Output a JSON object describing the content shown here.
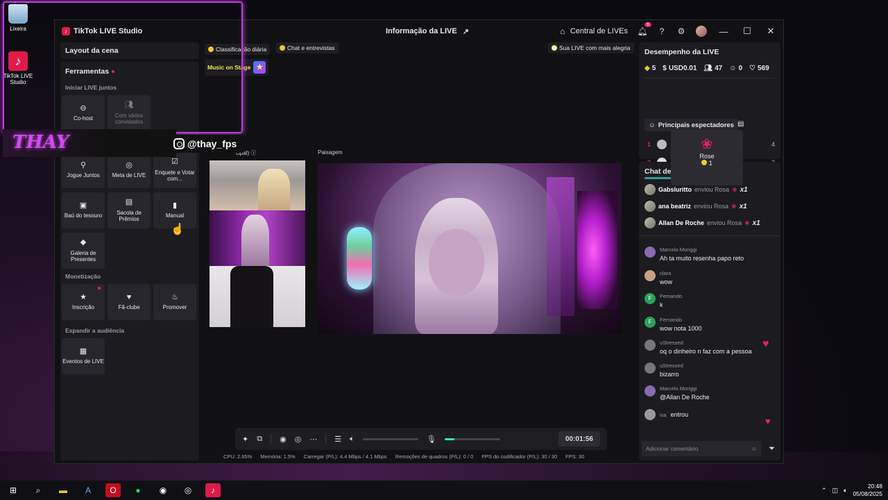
{
  "desktop": {
    "icons": [
      {
        "label": "Lixeira"
      },
      {
        "label": "TikTok LIVE Studio"
      }
    ],
    "overlay_handle": "@thay_fps",
    "overlay_logo": "THAY"
  },
  "app": {
    "title": "TikTok LIVE Studio",
    "live_info": "Informação da LIVE",
    "central": "Central de LIVEs",
    "notif_count": "6"
  },
  "left": {
    "scene_layout": "Layout da cena",
    "tools_title": "Ferramentas",
    "group1": "Iniciar LIVE juntos",
    "tiles1": [
      {
        "label": "Co-host",
        "icon": "link-icon"
      },
      {
        "label": "Com vários convidados",
        "icon": "users-icon"
      }
    ],
    "tiles2": [
      {
        "label": "Jogue Juntos"
      },
      {
        "label": "Meta de LIVE"
      },
      {
        "label": "Enquete e Votar com..."
      },
      {
        "label": "Baú do tesouro"
      },
      {
        "label": "Sacola de Prêmios"
      },
      {
        "label": "Manual"
      },
      {
        "label": "Galeria de Presentes"
      }
    ],
    "group2": "Monetização",
    "tiles3": [
      {
        "label": "Inscrição"
      },
      {
        "label": "Fã-clube"
      },
      {
        "label": "Promover"
      }
    ],
    "group3": "Expandir a audiência",
    "tiles4": [
      {
        "label": "Eventos de LIVE"
      }
    ]
  },
  "center": {
    "chip_class": "Classificação diária",
    "chip_chat": "Chat e entrevistas",
    "chip_happy": "Sua LIVE com mais alegria",
    "music_stage": "Music on Stage",
    "cam_main": "cipal)",
    "cam_land": "Paisagem",
    "timer": "00:01:56",
    "mic_level": 0.18,
    "status": [
      "CPU:  2.65%",
      "Memória:  1.5%",
      "Carregar (P/L):  4.4 Mbps / 4.1 Mbps",
      "Remoções de quadros (P/L):  0 / 0",
      "FPS do codificador (P/L):  30 / 30",
      "FPS:  30"
    ]
  },
  "right": {
    "perf_title": "Desempenho da LIVE",
    "stats": {
      "diamonds": "5",
      "usd": "USD0.01",
      "viewers": "47",
      "follows": "0",
      "likes": "569"
    },
    "top_viewers": "Principais espectadores",
    "ranks": [
      {
        "rank": "1",
        "value": "4"
      },
      {
        "rank": "2",
        "value": "3"
      }
    ],
    "tooltip": {
      "gift": "Rose",
      "cost": "1"
    },
    "chat_title": "Chat de LIVE",
    "gifts": [
      {
        "user": "Gabsluritto",
        "verb": "enviou Rosa",
        "mult": "x1"
      },
      {
        "user": "ana beatriz",
        "verb": "enviou Rosa",
        "mult": "x1"
      },
      {
        "user": "Allan De Roche",
        "verb": "enviou Rosa",
        "mult": "x1"
      }
    ],
    "messages": [
      {
        "name": "Marcelo Moriggi",
        "text": "Ah ta muito resenha papo reto"
      },
      {
        "name": "clara",
        "text": "wow"
      },
      {
        "name": "Fernando",
        "text": "k",
        "initial": "F"
      },
      {
        "name": "Fernando",
        "text": "wow nota 1000",
        "initial": "F"
      },
      {
        "name": "uStressed",
        "text": "oq o dinheiro n faz com a pessoa"
      },
      {
        "name": "uStressed",
        "text": "bizarro"
      },
      {
        "name": "Marcelo Moriggi",
        "text": "@Allan De Roche"
      }
    ],
    "joined_user": "isa",
    "joined_text": "entrou",
    "comment_placeholder": "Adicionar comentário"
  },
  "taskbar": {
    "time": "20:48",
    "date": "05/08/2025"
  }
}
